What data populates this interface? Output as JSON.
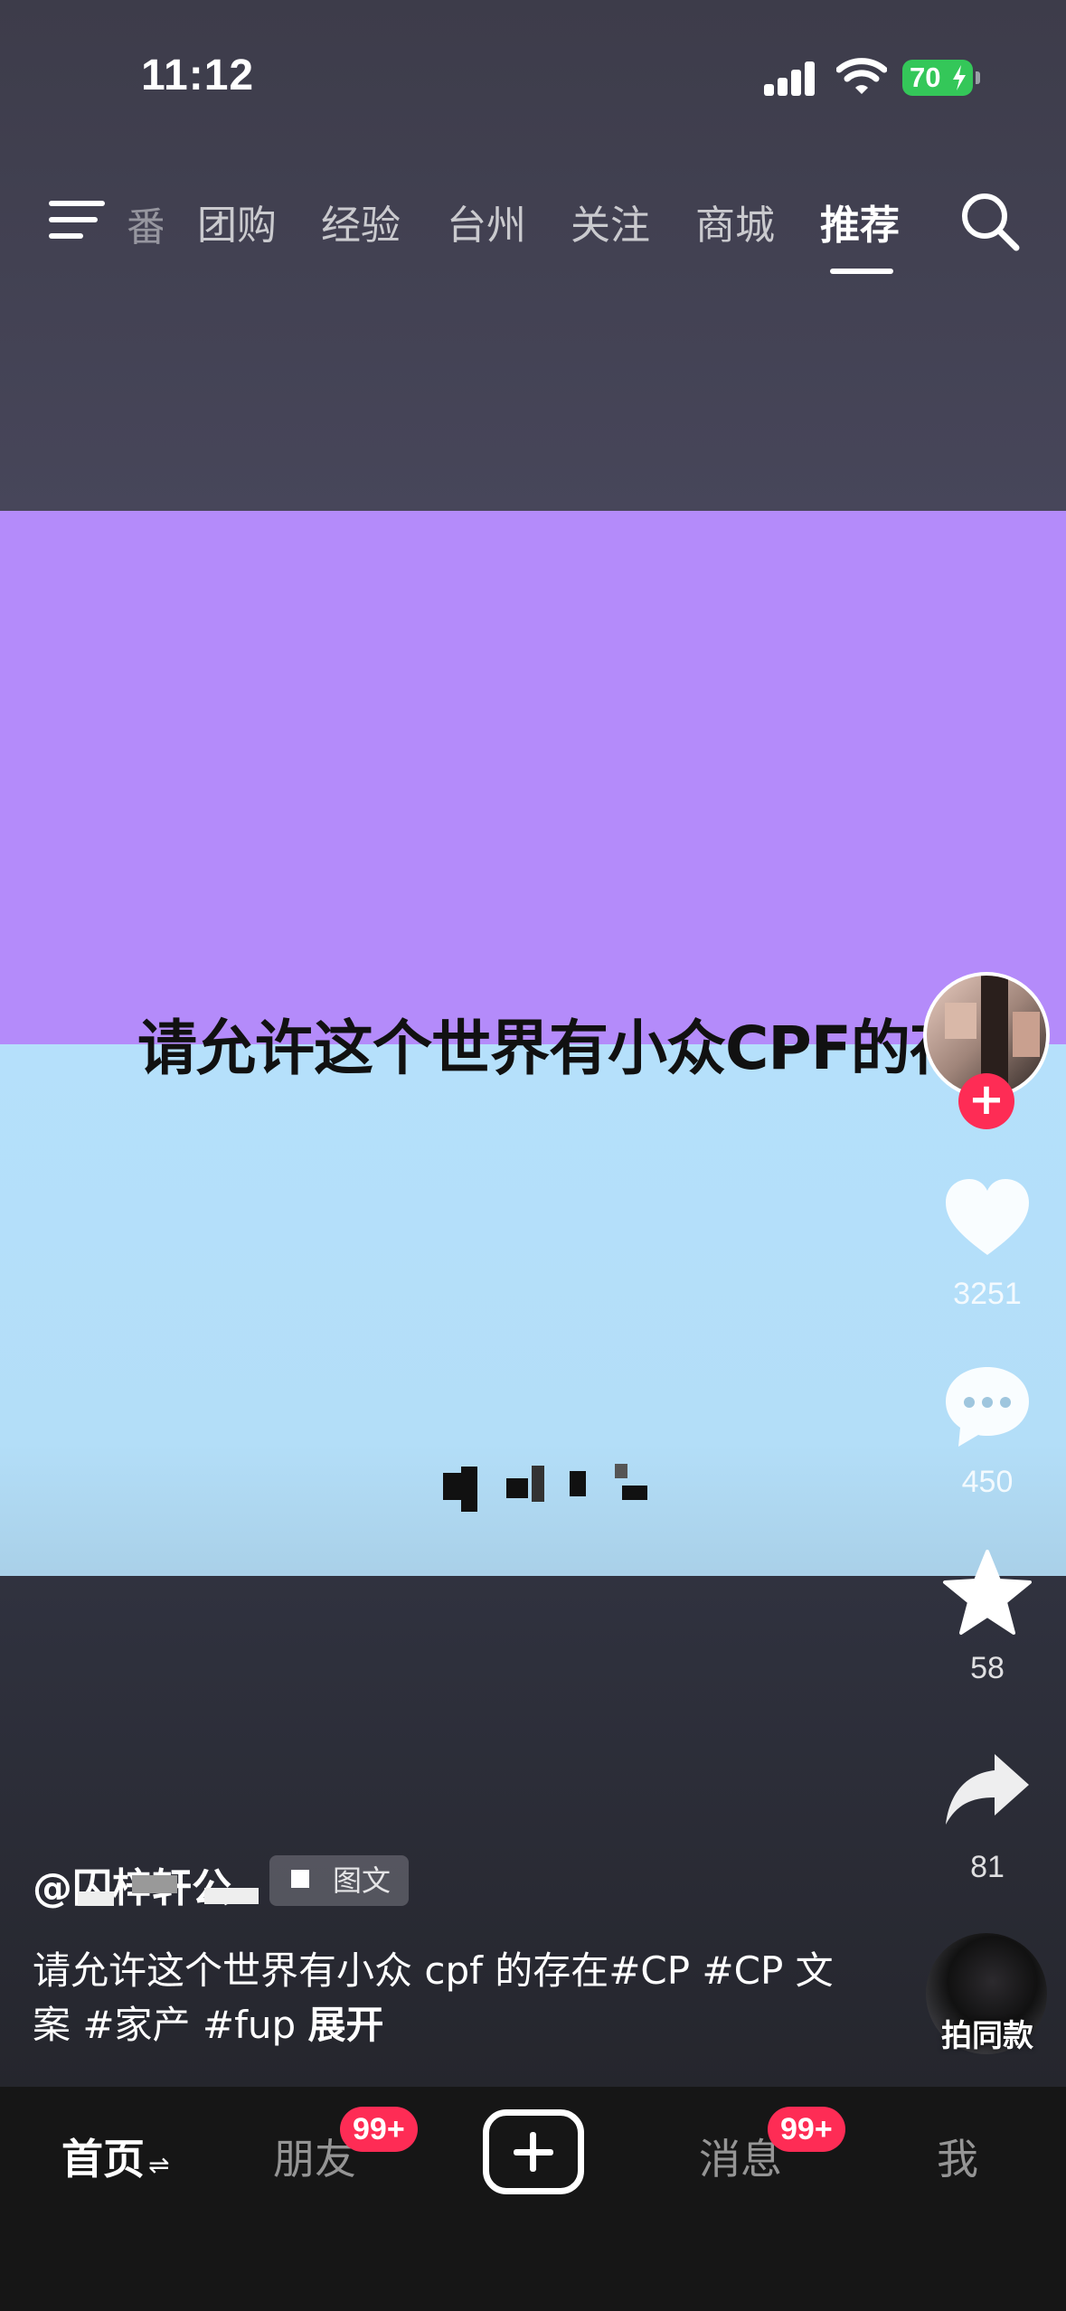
{
  "status_bar": {
    "time": "11:12",
    "battery": "70"
  },
  "top_nav": {
    "partial_tab": "番",
    "tabs": [
      "团购",
      "经验",
      "台州",
      "关注",
      "商城",
      "推荐"
    ],
    "active_tab": "推荐"
  },
  "content": {
    "overlay_title": "请允许这个世界有小众CPF的存在"
  },
  "actions": {
    "follow": "+",
    "likes": "3251",
    "comments": "450",
    "favorites": "58",
    "shares": "81"
  },
  "post": {
    "author_visible": "@囚梓轩公",
    "tag": "图文",
    "caption": "请允许这个世界有小众 cpf 的存在#CP #CP 文案 #家产 #fup",
    "expand": "展开",
    "same_style": "拍同款"
  },
  "tab_bar": {
    "home": "首页",
    "home_swap": "⇌",
    "friends": "朋友",
    "friends_badge": "99+",
    "messages": "消息",
    "messages_badge": "99+",
    "me": "我"
  },
  "colors": {
    "purple_panel": "#b48bfa",
    "blue_panel": "#b5e0fb",
    "accent_red": "#fe2c55",
    "battery_green": "#34c759"
  }
}
